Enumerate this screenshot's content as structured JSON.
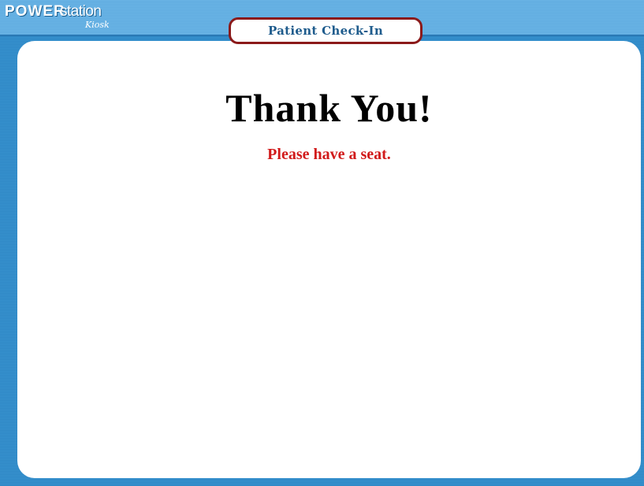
{
  "header": {
    "logo": {
      "power": "POWER",
      "station": "station",
      "kiosk": "Kiosk"
    },
    "title": "Patient Check-In"
  },
  "main": {
    "heading": "Thank You!",
    "message": "Please have a seat."
  },
  "colors": {
    "background_blue": "#3a93cf",
    "tab_border": "#8b1a1a",
    "title_text": "#1e5b8c",
    "message_red": "#d11a1a"
  }
}
